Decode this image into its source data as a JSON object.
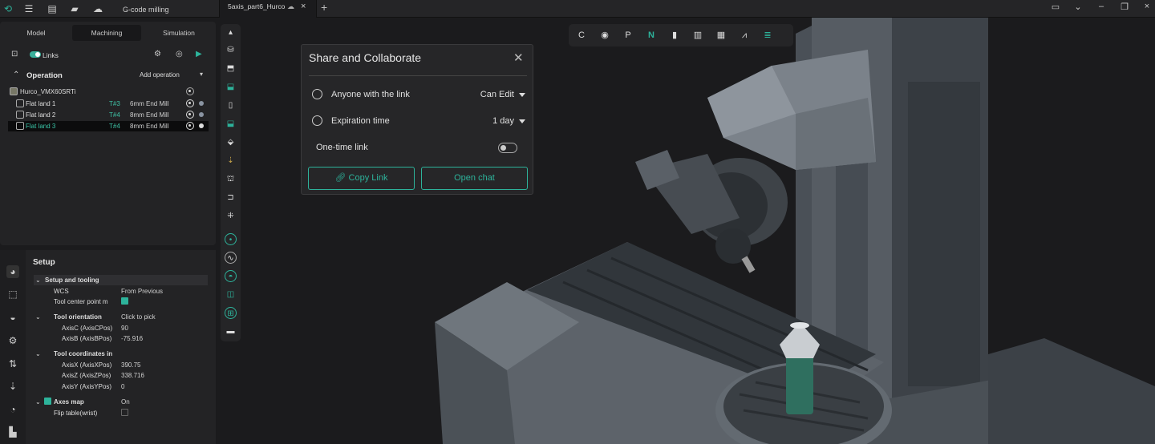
{
  "titlebar": {
    "app_title": "G-code milling",
    "tab_name": "5axis_part6_Hurco"
  },
  "left_panel": {
    "tabs": [
      "Model",
      "Machining",
      "Simulation"
    ],
    "active_tab": "Machining",
    "links_label": "Links",
    "operation_title": "Operation",
    "add_operation": "Add operation",
    "machine": "Hurco_VMX60SRTi",
    "operations": [
      {
        "name": "Flat land 1",
        "tool_num": "T#3",
        "tool": "6mm End Mill"
      },
      {
        "name": "Flat land 2",
        "tool_num": "T#4",
        "tool": "8mm End Mill"
      },
      {
        "name": "Flat land 3",
        "tool_num": "T#4",
        "tool": "8mm End Mill"
      }
    ]
  },
  "setup": {
    "title": "Setup",
    "section_setup_tooling": "Setup and tooling",
    "wcs_label": "WCS",
    "wcs_value": "From Previous",
    "tcp_label": "Tool center point m",
    "tool_orientation": "Tool orientation",
    "tool_orientation_value": "Click to pick",
    "axisc_label": "AxisC (AxisCPos)",
    "axisc_value": "90",
    "axisb_label": "AxisB (AxisBPos)",
    "axisb_value": "-75.916",
    "tool_coordinates": "Tool coordinates in",
    "axisx_label": "AxisX (AxisXPos)",
    "axisx_value": "390.75",
    "axisz_label": "AxisZ (AxisZPos)",
    "axisz_value": "338.716",
    "axisy_label": "AxisY (AxisYPos)",
    "axisy_value": "0",
    "axes_map": "Axes map",
    "axes_map_value": "On",
    "flip_table": "Flip table(wrist)"
  },
  "dialog": {
    "title": "Share and Collaborate",
    "link_access_label": "Anyone with the link",
    "link_access_value": "Can Edit",
    "expiration_label": "Expiration time",
    "expiration_value": "1 day",
    "one_time_label": "One-time link",
    "copy_link": "Copy Link",
    "open_chat": "Open chat"
  },
  "colors": {
    "accent": "#2db39b",
    "panel": "#232325",
    "background": "#1b1b1d"
  }
}
